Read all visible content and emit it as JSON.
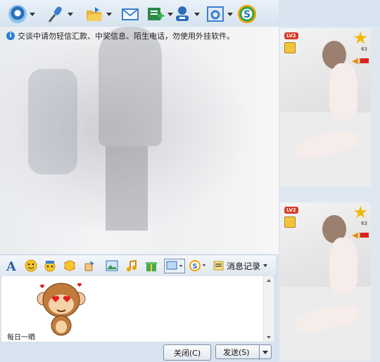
{
  "toolbar": {
    "buttons": [
      {
        "name": "video-call-button",
        "icon": "webcam-icon",
        "has_menu": true
      },
      {
        "name": "voice-call-button",
        "icon": "microphone-icon",
        "has_menu": true
      },
      {
        "name": "send-file-button",
        "icon": "folder-open-icon",
        "has_menu": true
      },
      {
        "name": "send-email-button",
        "icon": "email-icon",
        "has_menu": false
      },
      {
        "name": "create-group-button",
        "icon": "add-group-icon",
        "has_menu": true
      },
      {
        "name": "remote-assist-button",
        "icon": "user-remote-icon",
        "has_menu": true
      },
      {
        "name": "app-settings-button",
        "icon": "gear-window-icon",
        "has_menu": true
      },
      {
        "name": "soso-button",
        "icon": "soso-icon",
        "has_menu": false
      }
    ]
  },
  "chat": {
    "notice": "交谈中请勿轻信汇款、中奖信息、陌生电话，勿使用外挂软件。"
  },
  "input_toolbar": {
    "items": [
      {
        "name": "font-button",
        "icon": "font-a-icon"
      },
      {
        "name": "emoticon-button",
        "icon": "smiley-icon"
      },
      {
        "name": "magic-emoticon-button",
        "icon": "magic-face-icon"
      },
      {
        "name": "shake-button",
        "icon": "shake-window-icon"
      },
      {
        "name": "voice-message-button",
        "icon": "hand-note-icon"
      },
      {
        "name": "send-image-button",
        "icon": "image-icon"
      },
      {
        "name": "music-button",
        "icon": "music-note-icon"
      },
      {
        "name": "gift-button",
        "icon": "gift-icon"
      },
      {
        "name": "screenshot-button",
        "icon": "screen-capture-icon"
      },
      {
        "name": "soso-search-button",
        "icon": "soso-icon"
      }
    ],
    "message_log_label": "消息记录"
  },
  "input": {
    "sticker_caption": "每日一晒"
  },
  "buttons": {
    "close_label": "关闭(C)",
    "send_label": "发送(S)"
  },
  "right_panel": {
    "cards": [
      {
        "level_badge": "LV2",
        "star_count": "63"
      },
      {
        "level_badge": "LV2",
        "star_count": "63"
      }
    ]
  },
  "colors": {
    "frame": "#d7e4f0",
    "toolbar_bg": "#e4edf6",
    "accent_blue": "#2a7fd8",
    "badge_red": "#d43a2e",
    "star_gold": "#f0b800"
  }
}
